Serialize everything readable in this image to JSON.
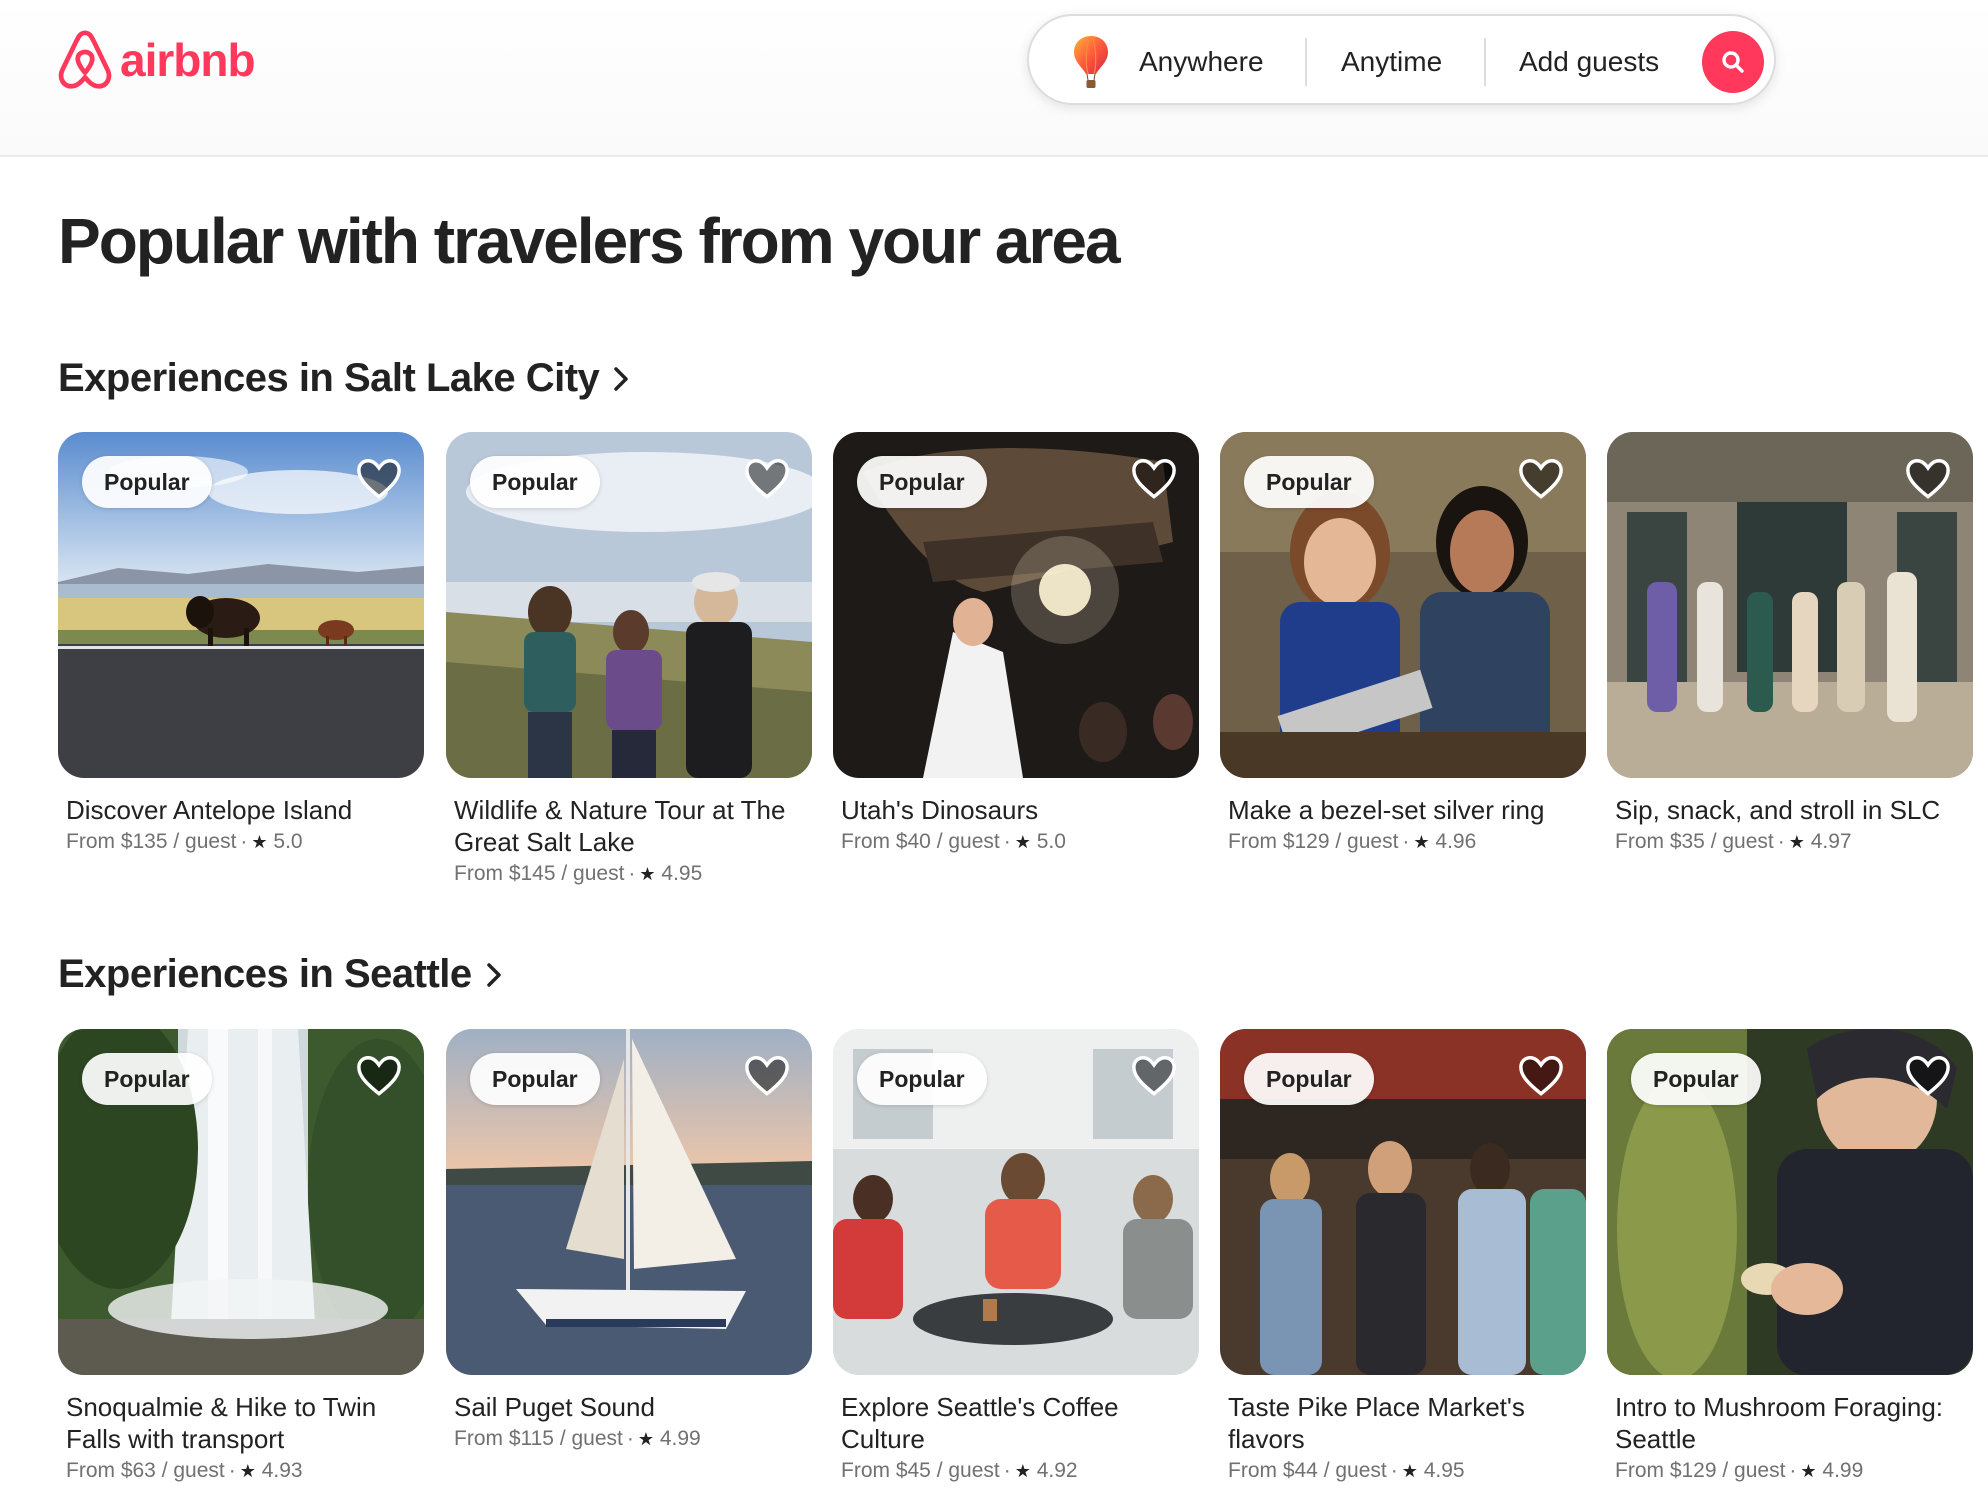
{
  "brand": {
    "name": "airbnb",
    "color": "#ff385c"
  },
  "search": {
    "anywhere": "Anywhere",
    "anytime": "Anytime",
    "guests": "Add guests",
    "icon": "search-icon",
    "accent": "#ff385c"
  },
  "page": {
    "title": "Popular with travelers from your area"
  },
  "sections": [
    {
      "title": "Experiences in Salt Lake City",
      "cards": [
        {
          "badge": "Popular",
          "title": "Discover Antelope Island",
          "price": "From $135 / guest",
          "rating": "5.0",
          "scene": "bison on roadside with lake and mountains"
        },
        {
          "badge": "Popular",
          "title": "Wildlife & Nature Tour at The Great Salt Lake",
          "price": "From $145 / guest",
          "rating": "4.95",
          "scene": "three people on a hill by a lake"
        },
        {
          "badge": "Popular",
          "title": "Utah's Dinosaurs",
          "price": "From $40 / guest",
          "rating": "5.0",
          "scene": "guide under dinosaur skeleton"
        },
        {
          "badge": "Popular",
          "title": "Make a bezel-set silver ring",
          "price": "From $129 / guest",
          "rating": "4.96",
          "scene": "two women smiling at a workbench"
        },
        {
          "badge": "",
          "title": "Sip, snack, and stroll in SLC",
          "price": "From $35 / guest",
          "rating": "4.97",
          "scene": "group standing in a hall"
        }
      ]
    },
    {
      "title": "Experiences in Seattle",
      "cards": [
        {
          "badge": "Popular",
          "title": "Snoqualmie & Hike to Twin Falls with transport",
          "price": "From $63 / guest",
          "rating": "4.93",
          "scene": "waterfall in forest"
        },
        {
          "badge": "Popular",
          "title": "Sail Puget Sound",
          "price": "From $115 / guest",
          "rating": "4.99",
          "scene": "sailboat on water at dusk"
        },
        {
          "badge": "Popular",
          "title": "Explore Seattle's Coffee Culture",
          "price": "From $45 / guest",
          "rating": "4.92",
          "scene": "people at a cafe"
        },
        {
          "badge": "Popular",
          "title": "Taste Pike Place Market's flavors",
          "price": "From $44 / guest",
          "rating": "4.95",
          "scene": "group at a market stall"
        },
        {
          "badge": "Popular",
          "title": "Intro to Mushroom Foraging: Seattle",
          "price": "From $129 / guest",
          "rating": "4.99",
          "scene": "woman examining mushroom"
        }
      ]
    }
  ]
}
